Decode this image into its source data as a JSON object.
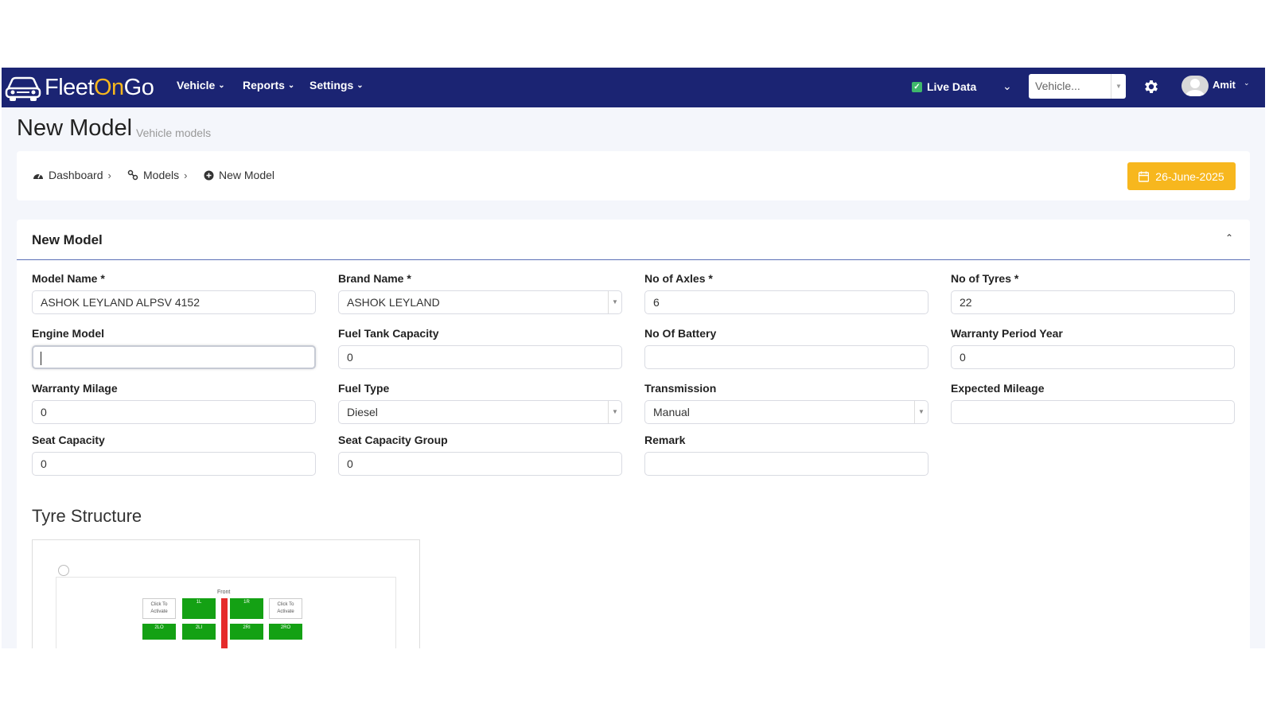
{
  "app": {
    "logo_part1": "Fleet",
    "logo_part2": "On",
    "logo_part3": "Go",
    "brand_color": "#1b2473",
    "accent_color": "#f7b71e"
  },
  "nav": {
    "menus": [
      "Vehicle",
      "Reports",
      "Settings"
    ],
    "live_data_label": "Live Data",
    "live_data_checked": true,
    "vehicle_select_placeholder": "Vehicle...",
    "user_name": "Amit"
  },
  "page": {
    "title": "New Model",
    "subtitle": "Vehicle models"
  },
  "breadcrumb": {
    "items": [
      "Dashboard",
      "Models",
      "New Model"
    ],
    "date": "26-June-2025"
  },
  "form": {
    "title": "New Model",
    "fields": [
      {
        "label": "Model Name *",
        "value": "ASHOK LEYLAND ALPSV 4152",
        "type": "text"
      },
      {
        "label": "Brand Name *",
        "value": "ASHOK LEYLAND",
        "type": "select"
      },
      {
        "label": "No of Axles *",
        "value": "6",
        "type": "text"
      },
      {
        "label": "No of Tyres *",
        "value": "22",
        "type": "text"
      },
      {
        "label": "Engine Model",
        "value": "",
        "type": "text",
        "focused": true
      },
      {
        "label": "Fuel Tank Capacity",
        "value": "0",
        "type": "text"
      },
      {
        "label": "No Of Battery",
        "value": "",
        "type": "text"
      },
      {
        "label": "Warranty Period Year",
        "value": "0",
        "type": "text"
      },
      {
        "label": "Warranty Milage",
        "value": "0",
        "type": "text"
      },
      {
        "label": "Fuel Type",
        "value": "Diesel",
        "type": "select"
      },
      {
        "label": "Transmission",
        "value": "Manual",
        "type": "select"
      },
      {
        "label": "Expected Mileage",
        "value": "",
        "type": "text"
      },
      {
        "label": "Seat Capacity",
        "value": "0",
        "type": "text"
      },
      {
        "label": "Seat Capacity Group",
        "value": "0",
        "type": "text"
      },
      {
        "label": "Remark",
        "value": "",
        "type": "text"
      }
    ]
  },
  "tyre_structure": {
    "title": "Tyre Structure",
    "front_label": "Front",
    "inactive_label": "Click To Activate",
    "tyres": [
      "1L",
      "1R",
      "2LO",
      "2LI",
      "2RI",
      "2RO"
    ],
    "active_color": "#14a114",
    "axle_color": "#e52b2b"
  }
}
